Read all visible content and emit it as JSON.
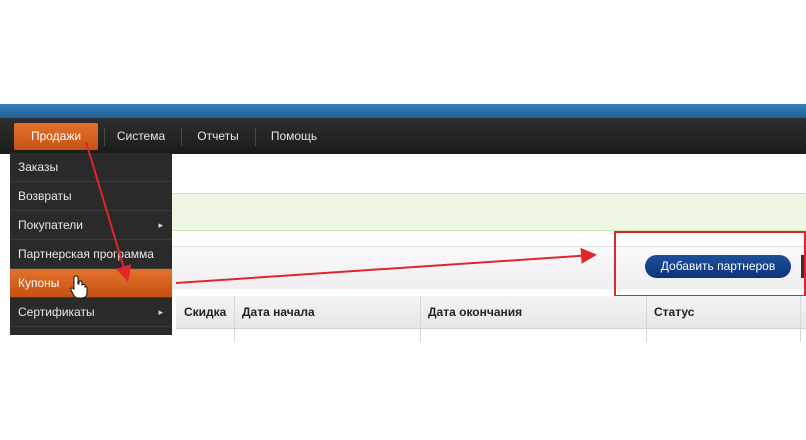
{
  "menubar": {
    "items": [
      {
        "label": "Продажи",
        "active": true
      },
      {
        "label": "Система",
        "active": false
      },
      {
        "label": "Отчеты",
        "active": false
      },
      {
        "label": "Помощь",
        "active": false
      }
    ]
  },
  "dropdown": {
    "items": [
      {
        "label": "Заказы",
        "has_submenu": false,
        "active": false
      },
      {
        "label": "Возвраты",
        "has_submenu": false,
        "active": false
      },
      {
        "label": "Покупатели",
        "has_submenu": true,
        "active": false
      },
      {
        "label": "Партнерская программа",
        "has_submenu": false,
        "active": false
      },
      {
        "label": "Купоны",
        "has_submenu": false,
        "active": true
      },
      {
        "label": "Сертификаты",
        "has_submenu": true,
        "active": false
      }
    ],
    "submenu_arrow": "▸"
  },
  "toolbar": {
    "add_partners_label": "Добавить партнеров"
  },
  "table": {
    "columns": [
      "Скидка",
      "Дата начала",
      "Дата окончания",
      "Статус"
    ]
  },
  "annotations": {
    "arrow_color": "#e0262b",
    "box_color": "#e0262b"
  },
  "colors": {
    "accent_orange": "#d9621f",
    "button_blue": "#13417f",
    "menubar": "#222222"
  },
  "icons": {
    "cursor": "hand-pointer-icon"
  }
}
